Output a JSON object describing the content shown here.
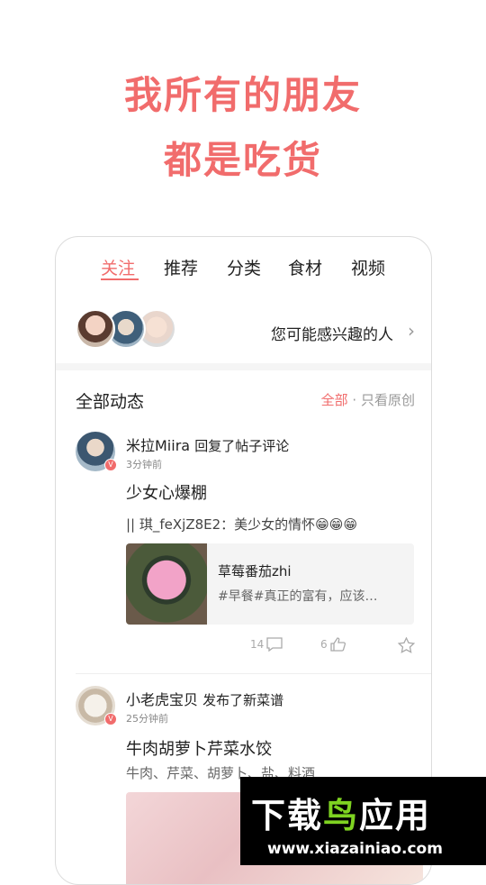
{
  "headline": {
    "line1": "我所有的朋友",
    "line2": "都是吃货"
  },
  "tabs": [
    {
      "label": "关注",
      "active": true
    },
    {
      "label": "推荐"
    },
    {
      "label": "分类"
    },
    {
      "label": "食材"
    },
    {
      "label": "视频"
    }
  ],
  "suggest": {
    "label": "您可能感兴趣的人",
    "icon": "chevron-right-icon"
  },
  "feed": {
    "title": "全部动态",
    "filter_all": "全部",
    "filter_dot": "·",
    "filter_original": "只看原创"
  },
  "posts": [
    {
      "name": "米拉Miira",
      "action": "回复了帖子评论",
      "time": "3分钟前",
      "title": "少女心爆棚",
      "quote": "|| 琪_feXjZ8E2：美少女的情怀😁😁😁",
      "recipe": {
        "name": "草莓番茄zhi",
        "desc": "#早餐#真正的富有，应该…"
      },
      "comments": "14",
      "likes": "6",
      "badge": "V"
    },
    {
      "name": "小老虎宝贝",
      "action": "发布了新菜谱",
      "time": "25分钟前",
      "title": "牛肉胡萝卜芹菜水饺",
      "ingredients": "牛肉、芹菜、胡萝卜、盐、料酒",
      "badge": "V"
    }
  ],
  "watermark": {
    "part1": "下载",
    "part2": "鸟",
    "part3": "应用",
    "url": "www.xiazainiao.com"
  },
  "colors": {
    "accent": "#f16c6c",
    "watermark_green": "#7ed321"
  }
}
